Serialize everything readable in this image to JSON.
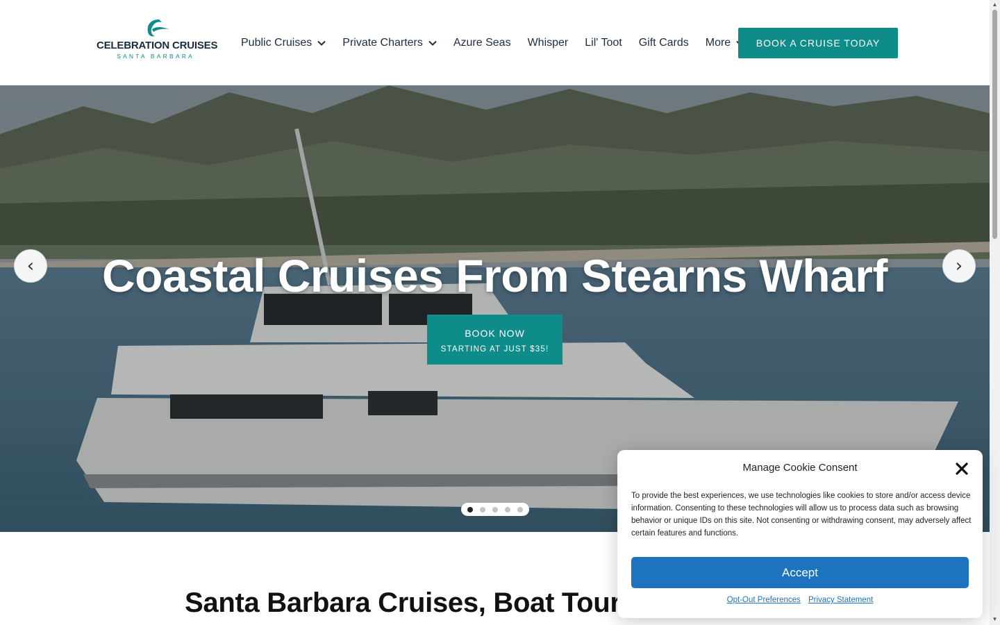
{
  "header": {
    "logo": {
      "name": "CELEBRATION CRUISES",
      "sub": "SANTA BARBARA",
      "icon": "wave-logo-icon"
    },
    "nav": [
      {
        "label": "Public Cruises",
        "dropdown": true
      },
      {
        "label": "Private Charters",
        "dropdown": true
      },
      {
        "label": "Azure Seas",
        "dropdown": false
      },
      {
        "label": "Whisper",
        "dropdown": false
      },
      {
        "label": "Lil' Toot",
        "dropdown": false
      },
      {
        "label": "Gift Cards",
        "dropdown": false
      },
      {
        "label": "More",
        "dropdown": true
      }
    ],
    "cta_label": "BOOK A CRUISE TODAY"
  },
  "hero": {
    "title": "Coastal Cruises From Stearns Wharf",
    "button_line1": "BOOK NOW",
    "button_line2": "STARTING AT JUST $35!",
    "prev_label": "‹",
    "next_label": "›",
    "slide_count": 5,
    "active_slide": 1
  },
  "section": {
    "title": "Santa Barbara Cruises, Boat Tours & ..."
  },
  "cookie": {
    "title": "Manage Cookie Consent",
    "text": "To provide the best experiences, we use technologies like cookies to store and/or access device information. Consenting to these technologies will allow us to process data such as browsing behavior or unique IDs on this site. Not consenting or withdrawing consent, may adversely affect certain features and functions.",
    "accept_label": "Accept",
    "opt_out_label": "Opt-Out Preferences",
    "privacy_label": "Privacy Statement"
  },
  "colors": {
    "teal": "#0e8c8a",
    "navy": "#1b2c40",
    "accept_blue": "#1e73be"
  }
}
